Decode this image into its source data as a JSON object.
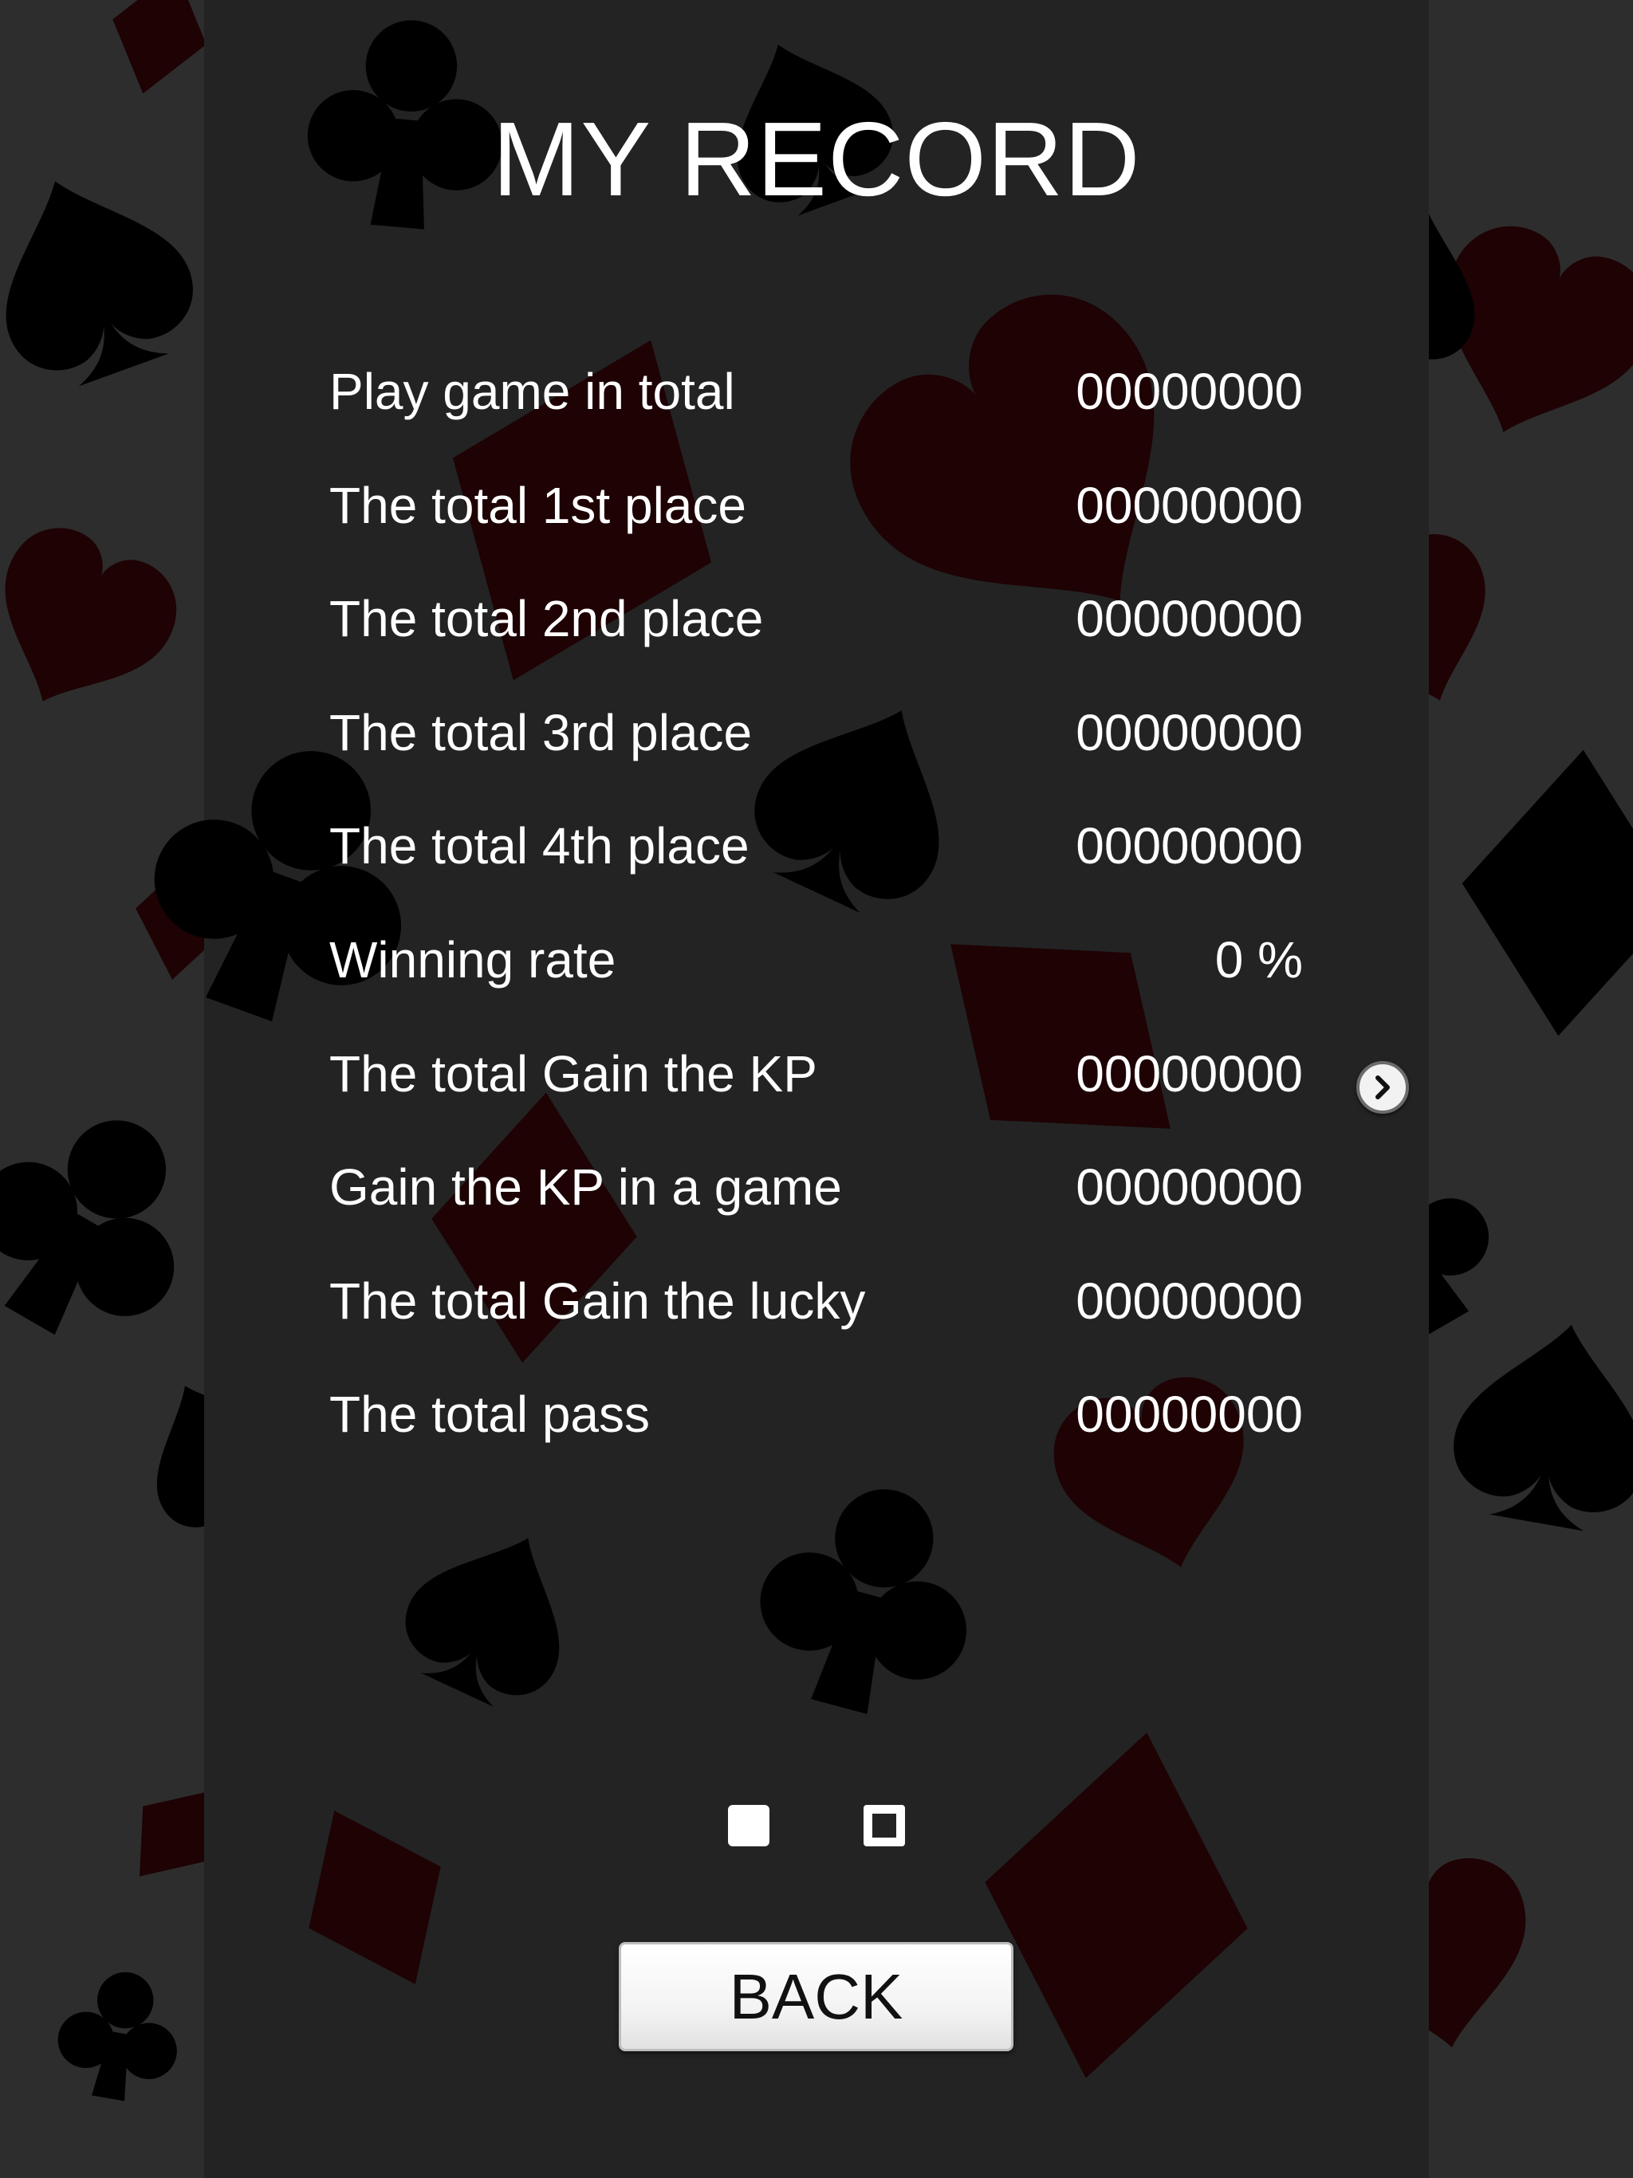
{
  "screen": {
    "title": "MY RECORD"
  },
  "stats": [
    {
      "label": "Play game in total",
      "value": "00000000"
    },
    {
      "label": "The total 1st place",
      "value": "00000000"
    },
    {
      "label": "The total 2nd place",
      "value": "00000000"
    },
    {
      "label": "The total 3rd place",
      "value": "00000000"
    },
    {
      "label": "The total 4th place",
      "value": "00000000"
    },
    {
      "label": "Winning rate",
      "value": "0 %"
    },
    {
      "label": "The total Gain the KP",
      "value": "00000000"
    },
    {
      "label": "Gain the KP in a game",
      "value": "00000000"
    },
    {
      "label": "The total Gain the lucky",
      "value": "00000000"
    },
    {
      "label": "The total pass",
      "value": "00000000"
    }
  ],
  "pagination": {
    "total_pages": 2,
    "current_page": 1
  },
  "buttons": {
    "back_label": "BACK",
    "next_icon": "chevron-right-icon"
  },
  "colors": {
    "background": "#2d2d2d",
    "panel": "#232323",
    "red_suit": "#1e0204",
    "black_suit": "#000000",
    "text": "#ffffff"
  }
}
